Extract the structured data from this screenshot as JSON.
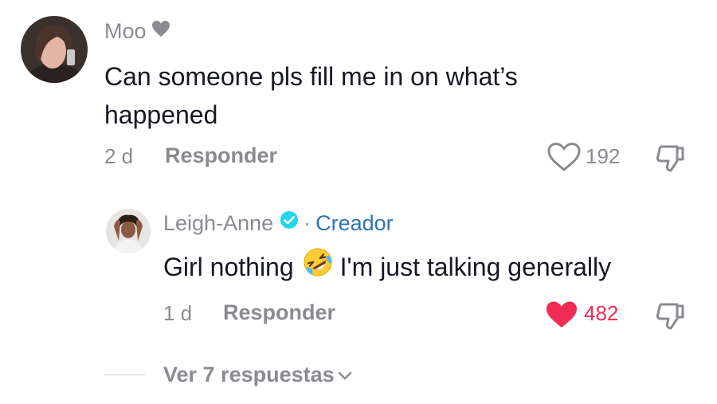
{
  "comments": [
    {
      "username": "Moo",
      "text": "Can someone pls fill me in on what’s happened",
      "time": "2 d",
      "reply_label": "Responder",
      "likes": "192",
      "liked": false
    },
    {
      "username": "Leigh-Anne",
      "separator": "·",
      "creator_label": "Creador",
      "text_before_emoji": "Girl nothing",
      "text_after_emoji": "I'm just talking generally",
      "time": "1 d",
      "reply_label": "Responder",
      "likes": "482",
      "liked": true
    }
  ],
  "view_replies_label": "Ver 7 respuestas",
  "icons": {
    "username_badge": "heart-icon",
    "verified": "verified-check-icon",
    "emoji": "rolling-on-floor-laughing-emoji",
    "like": "heart-outline-icon",
    "like_active": "heart-filled-icon",
    "dislike": "thumbs-down-icon",
    "expand": "chevron-down-icon"
  },
  "colors": {
    "text_primary": "#161823",
    "text_secondary": "#8a8b91",
    "like_active": "#f02c55",
    "creator": "#2b74b8",
    "verified": "#20d5ec"
  }
}
